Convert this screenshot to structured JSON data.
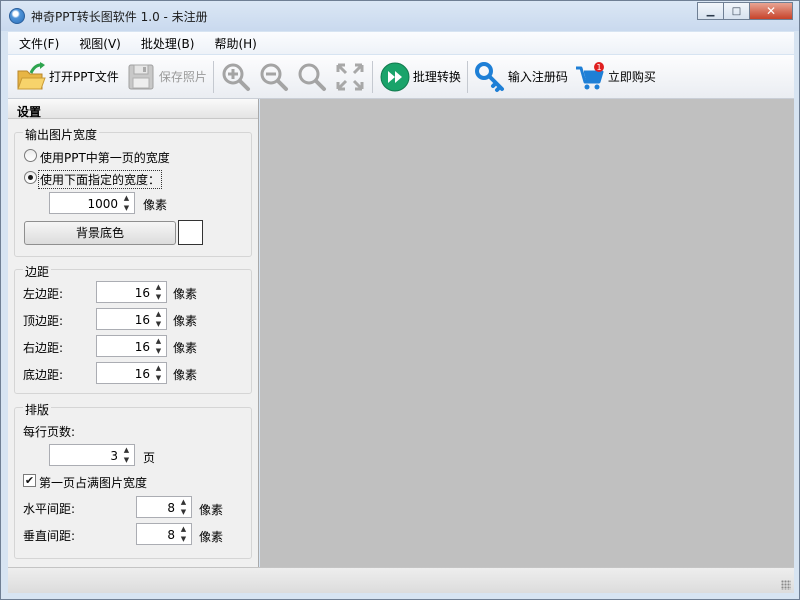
{
  "window": {
    "title": "神奇PPT转长图软件 1.0 - 未注册"
  },
  "menu": [
    "文件(F)",
    "视图(V)",
    "批处理(B)",
    "帮助(H)"
  ],
  "toolbar": {
    "open_ppt": "打开PPT文件",
    "save_images": "保存照片",
    "batch_convert": "批理转换",
    "enter_code": "输入注册码",
    "buy_now": "立即购买",
    "cart_badge": "1"
  },
  "settings": {
    "header": "设置",
    "output_width": {
      "title": "输出图片宽度",
      "option_first_page": "使用PPT中第一页的宽度",
      "option_custom": "使用下面指定的宽度：",
      "selected": "custom",
      "width_value": "1000",
      "unit": "像素",
      "bg_color_button": "背景底色",
      "bg_color": "#ffffff"
    },
    "margins": {
      "title": "边距",
      "unit": "像素",
      "left_label": "左边距:",
      "left_value": "16",
      "top_label": "顶边距:",
      "top_value": "16",
      "right_label": "右边距:",
      "right_value": "16",
      "bottom_label": "底边距:",
      "bottom_value": "16"
    },
    "layout": {
      "title": "排版",
      "pages_per_row_label": "每行页数:",
      "pages_per_row_value": "3",
      "pages_unit": "页",
      "first_page_full_label": "第一页占满图片宽度",
      "first_page_full_checked": true,
      "h_gap_label": "水平间距:",
      "h_gap_value": "8",
      "v_gap_label": "垂直间距:",
      "v_gap_value": "8",
      "gap_unit": "像素"
    }
  },
  "colors": {
    "canvas": "#c0c0c0",
    "accent_green": "#1aa36a",
    "accent_blue": "#1e7fd6"
  }
}
